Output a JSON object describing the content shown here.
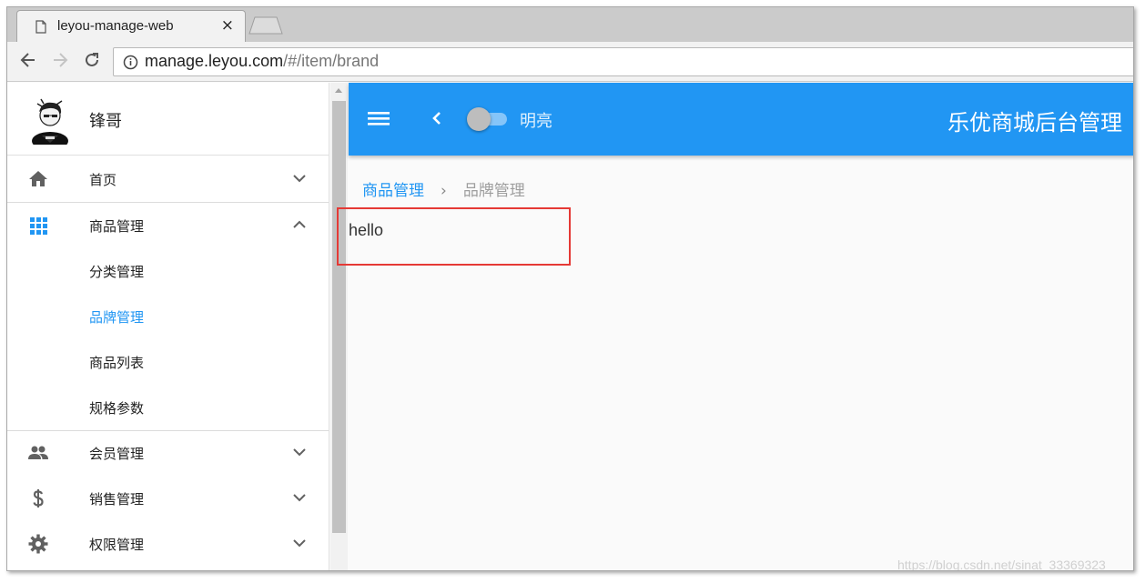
{
  "browser": {
    "tab_title": "leyou-manage-web",
    "tab_close": "×",
    "url_host": "manage.leyou.com",
    "url_path": "/#/item/brand"
  },
  "sidebar": {
    "user_name": "锋哥",
    "items": [
      {
        "label": "首页",
        "icon": "home-icon"
      },
      {
        "label": "商品管理",
        "icon": "apps-grid-icon",
        "expanded": true,
        "children": [
          {
            "label": "分类管理"
          },
          {
            "label": "品牌管理",
            "active": true
          },
          {
            "label": "商品列表"
          },
          {
            "label": "规格参数"
          }
        ]
      },
      {
        "label": "会员管理",
        "icon": "people-icon"
      },
      {
        "label": "销售管理",
        "icon": "dollar-icon"
      },
      {
        "label": "权限管理",
        "icon": "gear-icon"
      }
    ]
  },
  "appbar": {
    "toggle_label": "明亮",
    "title": "乐优商城后台管理",
    "toggle_on": false
  },
  "breadcrumb": {
    "parent": "商品管理",
    "separator": "›",
    "current": "品牌管理"
  },
  "content": {
    "text": "hello"
  },
  "watermark": "https://blog.csdn.net/sinat_33369323",
  "colors": {
    "primary": "#2196f3",
    "highlight": "#e53935"
  }
}
